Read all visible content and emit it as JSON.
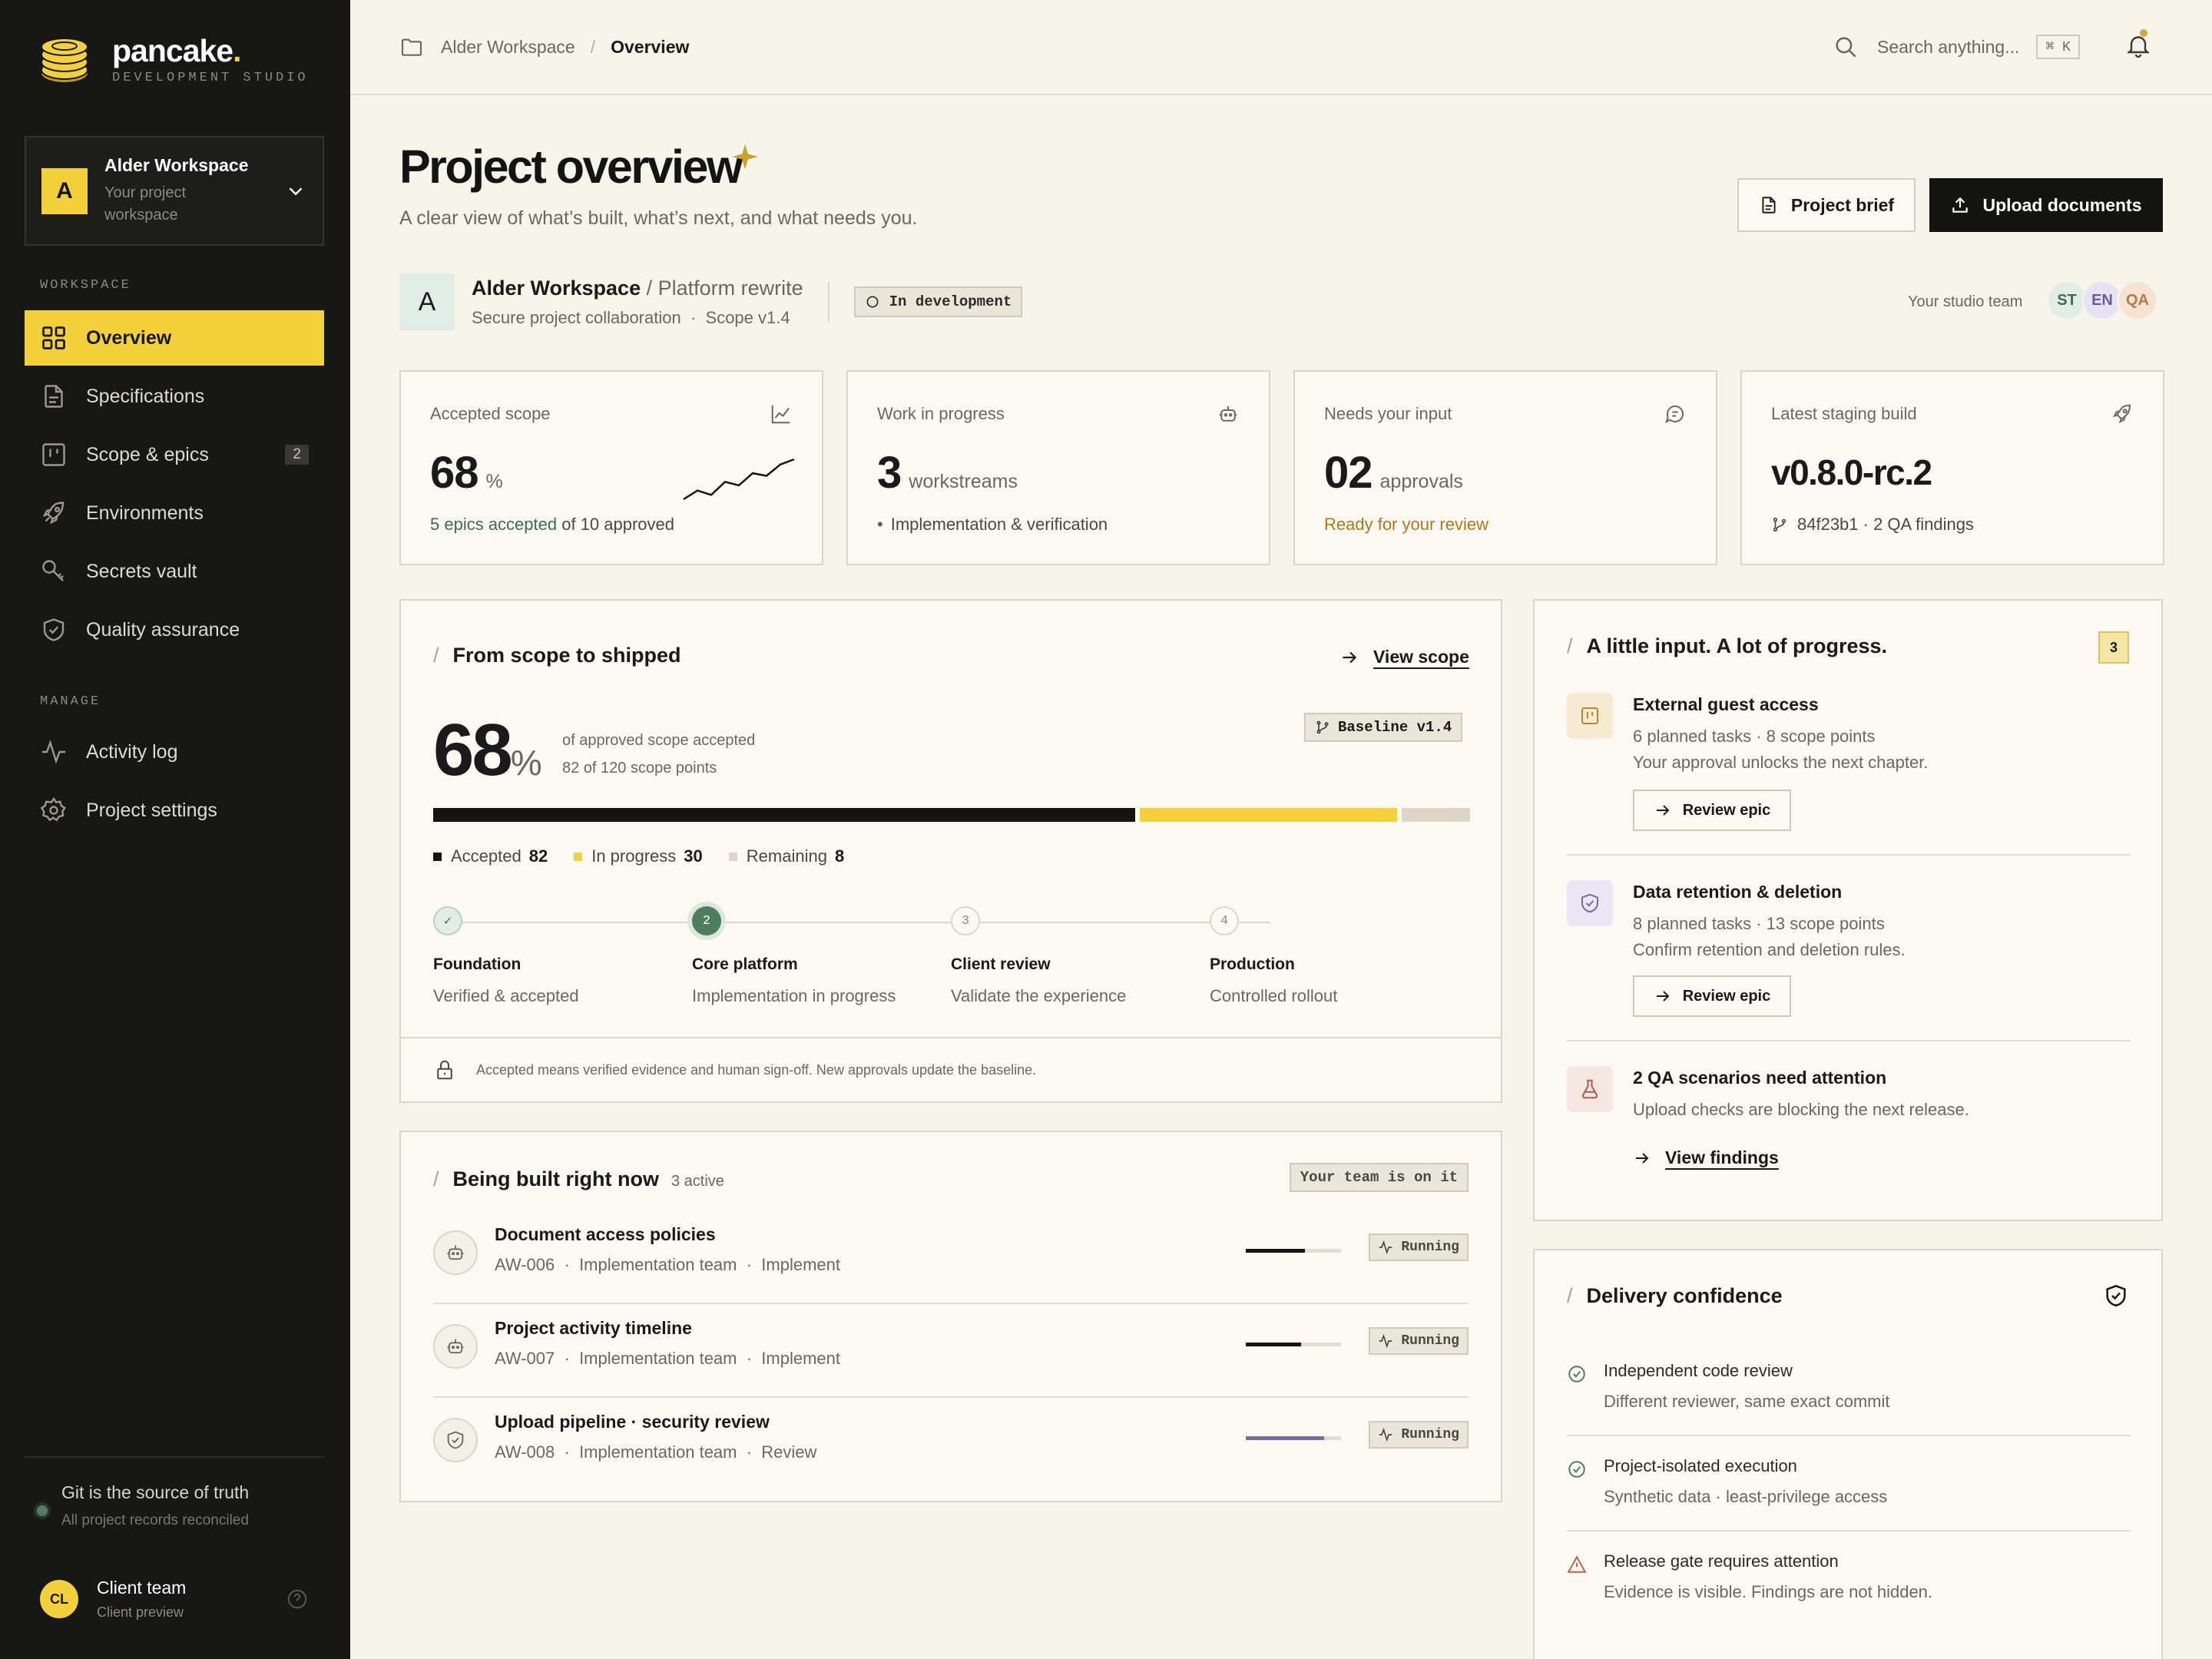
{
  "brand": {
    "name": "pancake",
    "dot": ".",
    "tagline": "DEVELOPMENT STUDIO"
  },
  "workspace": {
    "initial": "A",
    "name": "Alder Workspace",
    "sub": "Your project workspace"
  },
  "sidebar": {
    "section_workspace": "WORKSPACE",
    "section_manage": "MANAGE",
    "items": [
      {
        "label": "Overview",
        "icon": "grid-icon",
        "active": true
      },
      {
        "label": "Specifications",
        "icon": "document-icon"
      },
      {
        "label": "Scope & epics",
        "icon": "kanban-icon",
        "badge": "2"
      },
      {
        "label": "Environments",
        "icon": "rocket-icon"
      },
      {
        "label": "Secrets vault",
        "icon": "key-icon"
      },
      {
        "label": "Quality assurance",
        "icon": "shield-icon"
      }
    ],
    "manage_items": [
      {
        "label": "Activity log",
        "icon": "activity-icon"
      },
      {
        "label": "Project settings",
        "icon": "settings-icon"
      }
    ],
    "git_title": "Git is the source of truth",
    "git_sub": "All project records reconciled",
    "user_initials": "CL",
    "user_name": "Client team",
    "user_sub": "Client preview"
  },
  "topbar": {
    "crumb_1": "Alder Workspace",
    "crumb_sep": "/",
    "crumb_2": "Overview",
    "search_placeholder": "Search anything...",
    "shortcut": "⌘ K"
  },
  "header": {
    "title": "Project overview",
    "subtitle": "A clear view of what’s built, what’s next, and what needs you.",
    "brief_label": "Project brief",
    "upload_label": "Upload documents"
  },
  "project": {
    "initial": "A",
    "name": "Alder Workspace",
    "platform": "/ Platform rewrite",
    "meta_1": "Secure project collaboration",
    "meta_dot": "·",
    "meta_2": "Scope v1.4",
    "status": "In development",
    "team_label": "Your studio team",
    "team": [
      {
        "initials": "ST",
        "bg": "#e3ede8",
        "fg": "#3d6b55"
      },
      {
        "initials": "EN",
        "bg": "#e7e3f3",
        "fg": "#6c5a9c"
      },
      {
        "initials": "QA",
        "bg": "#f6e3d3",
        "fg": "#b57a45"
      }
    ]
  },
  "stats": [
    {
      "label": "Accepted scope",
      "value": "68",
      "unit": "%",
      "foot_accent": "5 epics accepted",
      "foot": "of 10 approved",
      "icon": "chart-icon",
      "sparkline": [
        2,
        3,
        2.5,
        4,
        3.6,
        5,
        4.7,
        6,
        6.6
      ]
    },
    {
      "label": "Work in progress",
      "value": "3",
      "unit": "workstreams",
      "foot": "Implementation & verification",
      "icon": "robot-icon"
    },
    {
      "label": "Needs your input",
      "value": "02",
      "unit": "approvals",
      "foot_accent": "Ready for your review",
      "icon": "chat-icon"
    },
    {
      "label": "Latest staging build",
      "value": "v0.8.0-rc.2",
      "foot": "84f23b1 · 2 QA findings",
      "icon": "rocket-icon"
    }
  ],
  "progress": {
    "title": "From scope to shipped",
    "link": "View scope",
    "percent": "68",
    "percent_sign": "%",
    "sub_1": "of approved scope accepted",
    "sub_2": "82 of 120 scope points",
    "baseline": "Baseline v1.4",
    "accepted": 82,
    "in_progress": 30,
    "remaining": 8,
    "total": 120,
    "legend": {
      "accepted": "Accepted",
      "in_progress": "In progress",
      "remaining": "Remaining"
    },
    "steps": [
      {
        "marker": "✓",
        "name": "Foundation",
        "sub": "Verified & accepted",
        "state": "done"
      },
      {
        "marker": "2",
        "name": "Core platform",
        "sub": "Implementation in progress",
        "state": "current"
      },
      {
        "marker": "3",
        "name": "Client review",
        "sub": "Validate the experience",
        "state": "todo"
      },
      {
        "marker": "4",
        "name": "Production",
        "sub": "Controlled rollout",
        "state": "todo"
      }
    ],
    "footnote": "Accepted means verified evidence and human sign-off. New approvals update the baseline."
  },
  "building": {
    "title": "Being built right now",
    "count": "3 active",
    "pill": "Your team is on it",
    "tasks": [
      {
        "name": "Document access policies",
        "id": "AW-006",
        "team": "Implementation team",
        "phase": "Implement",
        "status": "Running",
        "progress": 0.62,
        "color": "#141413",
        "icon": "robot-icon"
      },
      {
        "name": "Project activity timeline",
        "id": "AW-007",
        "team": "Implementation team",
        "phase": "Implement",
        "status": "Running",
        "progress": 0.58,
        "color": "#141413",
        "icon": "robot-icon"
      },
      {
        "name": "Upload pipeline · security review",
        "id": "AW-008",
        "team": "Implementation team",
        "phase": "Review",
        "status": "Running",
        "progress": 0.82,
        "color": "#7a6a9a",
        "icon": "shield-icon"
      }
    ],
    "dot": "·"
  },
  "input": {
    "title": "A little input. A lot of progress.",
    "count": "3",
    "items": [
      {
        "title": "External guest access",
        "line_1": "6 planned tasks · 8 scope points",
        "line_2": "Your approval unlocks the next chapter.",
        "action": "Review epic"
      },
      {
        "title": "Data retention & deletion",
        "line_1": "8 planned tasks · 13 scope points",
        "line_2": "Confirm retention and deletion rules.",
        "action": "Review epic"
      },
      {
        "title": "2 QA scenarios need attention",
        "line_1": "Upload checks are blocking the next release.",
        "action": "View findings"
      }
    ]
  },
  "delivery": {
    "title": "Delivery confidence",
    "items": [
      {
        "title": "Independent code review",
        "sub": "Different reviewer, same exact commit",
        "state": "ok"
      },
      {
        "title": "Project-isolated execution",
        "sub": "Synthetic data · least-privilege access",
        "state": "ok"
      },
      {
        "title": "Release gate requires attention",
        "sub": "Evidence is visible. Findings are not hidden.",
        "state": "warn"
      }
    ]
  },
  "colors": {
    "accent": "#f2d13b",
    "dark": "#141413",
    "green": "#4e7e5e",
    "amber": "#a87b1e",
    "bg": "#f7f4ea"
  }
}
